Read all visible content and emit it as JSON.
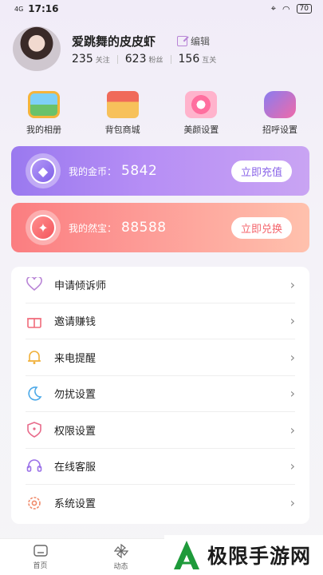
{
  "status": {
    "time": "17:16",
    "network": "4G",
    "battery": "70"
  },
  "profile": {
    "nickname": "爱跳舞的皮皮虾",
    "edit_label": "编辑",
    "stats": [
      {
        "num": "235",
        "label": "关注"
      },
      {
        "num": "623",
        "label": "粉丝"
      },
      {
        "num": "156",
        "label": "互关"
      }
    ]
  },
  "quick_actions": [
    {
      "label": "我的相册",
      "icon": "photo-album-icon"
    },
    {
      "label": "背包商城",
      "icon": "shop-icon"
    },
    {
      "label": "美颜设置",
      "icon": "beauty-flower-icon"
    },
    {
      "label": "招呼设置",
      "icon": "chat-bubble-icon"
    }
  ],
  "coins_card": {
    "label": "我的金币：",
    "value": "5842",
    "button": "立即充值",
    "color": "#9a79ef"
  },
  "treasure_card": {
    "label": "我的然宝：",
    "value": "88588",
    "button": "立即兑换",
    "color": "#fb7d80"
  },
  "menu": [
    {
      "label": "申请倾诉师",
      "icon": "heart-icon",
      "color": "#b884d6"
    },
    {
      "label": "邀请赚钱",
      "icon": "gift-icon",
      "color": "#f06a7a"
    },
    {
      "label": "来电提醒",
      "icon": "bell-icon",
      "color": "#f0b03a"
    },
    {
      "label": "勿扰设置",
      "icon": "moon-icon",
      "color": "#4aa8e8"
    },
    {
      "label": "权限设置",
      "icon": "shield-icon",
      "color": "#e86a8a"
    },
    {
      "label": "在线客服",
      "icon": "headset-icon",
      "color": "#9a70e8"
    },
    {
      "label": "系统设置",
      "icon": "gear-icon",
      "color": "#f08a6a"
    }
  ],
  "tabs": [
    {
      "label": "首页",
      "icon": "home-icon"
    },
    {
      "label": "动态",
      "icon": "pinwheel-icon"
    }
  ],
  "watermark": {
    "text": "极限手游网"
  }
}
